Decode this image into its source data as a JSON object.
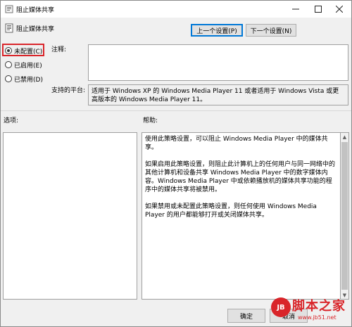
{
  "window": {
    "title": "阻止媒体共享"
  },
  "header": {
    "title": "阻止媒体共享",
    "prev_label": "上一个设置(P)",
    "next_label": "下一个设置(N)"
  },
  "state": {
    "options": [
      {
        "label": "未配置(C)",
        "checked": true
      },
      {
        "label": "已启用(E)",
        "checked": false
      },
      {
        "label": "已禁用(D)",
        "checked": false
      }
    ]
  },
  "comment": {
    "label": "注释:",
    "value": ""
  },
  "platform": {
    "label": "支持的平台:",
    "value": "适用于 Windows XP 的 Windows Media Player 11 或者适用于 Windows Vista 或更高版本的 Windows Media Player 11。"
  },
  "options_label": "选项:",
  "help": {
    "label": "帮助:",
    "paragraphs": [
      "使用此策略设置，可以阻止 Windows Media Player 中的媒体共享。",
      "如果启用此策略设置，则阻止此计算机上的任何用户与同一网络中的其他计算机和设备共享 Windows Media Player 中的数字媒体内容。Windows Media Player 中或依赖播放机的媒体共享功能的程序中的媒体共享将被禁用。",
      "如果禁用或未配置此策略设置，则任何使用 Windows Media Player 的用户都能够打开或关闭媒体共享。"
    ]
  },
  "buttons": {
    "ok": "确定",
    "cancel": "取消"
  },
  "watermark": {
    "logo": "JB",
    "text": "脚本之家",
    "url": "www.jb51.net"
  }
}
